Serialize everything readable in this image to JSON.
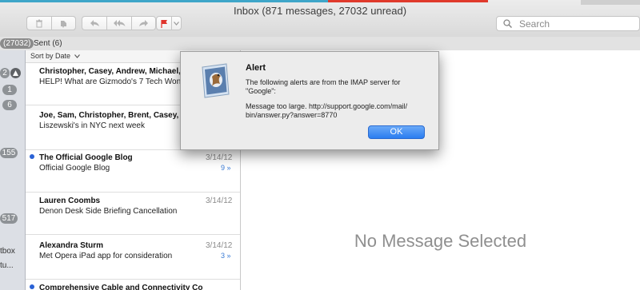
{
  "window": {
    "title": "Inbox (871 messages, 27032 unread)"
  },
  "toolbar": {
    "search_placeholder": "Search",
    "buttons": [
      "trash-icon",
      "junk-icon",
      "reply-icon",
      "reply-all-icon",
      "forward-icon",
      "flag-icon",
      "chevron-down-icon"
    ]
  },
  "favorites": {
    "inbox_count": "(27032)",
    "sent_label": "Sent (6)"
  },
  "sidebar": {
    "badges": [
      "2",
      "1",
      "6",
      "155",
      "517"
    ],
    "labels": [
      "tbox",
      "tu..."
    ]
  },
  "list": {
    "sort_label": "Sort by Date",
    "messages": [
      {
        "from": "Christopher, Casey, Andrew, Michael, Ky",
        "subject": "HELP! What are Gizmodo's 7 Tech Wond",
        "date": "",
        "count": "",
        "unread": false
      },
      {
        "from": "Joe, Sam, Christopher, Brent, Casey, Ky",
        "subject": "Liszewski's in NYC next week",
        "date": "",
        "count": "",
        "unread": false
      },
      {
        "from": "The Official Google Blog",
        "subject": "Official Google Blog",
        "date": "3/14/12",
        "count": "9 »",
        "unread": true
      },
      {
        "from": "Lauren Coombs",
        "subject": "Denon Desk Side Briefing Cancellation",
        "date": "3/14/12",
        "count": "",
        "unread": false
      },
      {
        "from": "Alexandra Sturm",
        "subject": "Met Opera iPad app for consideration",
        "date": "3/14/12",
        "count": "3 »",
        "unread": false
      },
      {
        "from": "Comprehensive Cable and Connectivity Co",
        "subject": "",
        "date": "",
        "count": "",
        "unread": true
      }
    ]
  },
  "preview": {
    "empty_text": "No Message Selected"
  },
  "alert": {
    "title": "Alert",
    "line1": "The following alerts are from the IMAP server for",
    "line2": "\"Google\":",
    "line3": "Message too large. http://support.google.com/mail/",
    "line4": "bin/answer.py?answer=8770",
    "ok_label": "OK"
  },
  "colors": {
    "accent": "#2a7df0",
    "unread_dot": "#2a62d6",
    "flag": "#e0332b"
  }
}
